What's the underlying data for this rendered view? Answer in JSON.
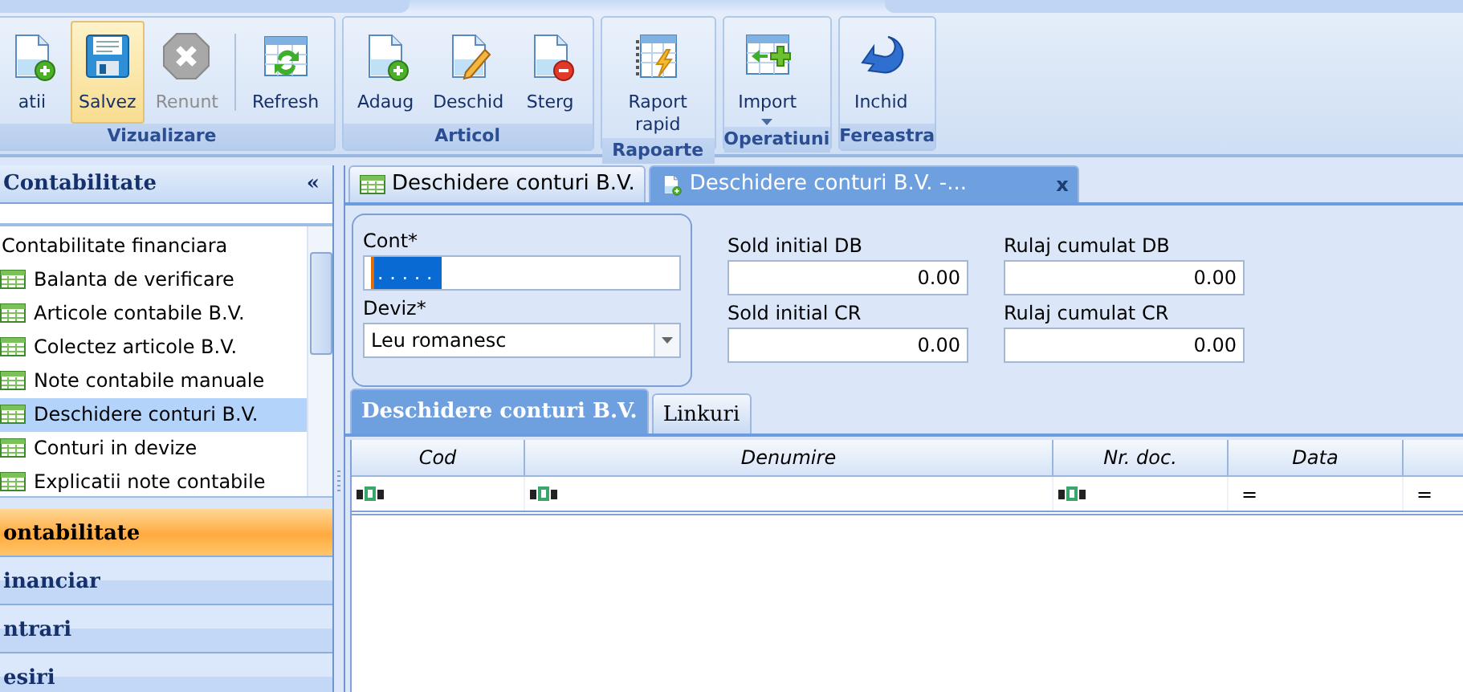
{
  "ribbon": {
    "groups": [
      {
        "label": "Vizualizare",
        "buttons": [
          {
            "label": "atii",
            "kind": "doc-add",
            "highlighted": false,
            "disabled": false
          },
          {
            "label": "Salvez",
            "kind": "save",
            "highlighted": true,
            "disabled": false
          },
          {
            "label": "Renunt",
            "kind": "cancel",
            "highlighted": false,
            "disabled": true
          },
          {
            "kind": "separator"
          },
          {
            "label": "Refresh",
            "kind": "refresh",
            "highlighted": false,
            "disabled": false
          }
        ]
      },
      {
        "label": "Articol",
        "buttons": [
          {
            "label": "Adaug",
            "kind": "doc-add",
            "highlighted": false,
            "disabled": false
          },
          {
            "label": "Deschid",
            "kind": "doc-edit",
            "highlighted": false,
            "disabled": false
          },
          {
            "label": "Sterg",
            "kind": "doc-remove",
            "highlighted": false,
            "disabled": false
          }
        ]
      },
      {
        "label": "Rapoarte",
        "buttons": [
          {
            "label": "Raport rapid",
            "kind": "report",
            "highlighted": false,
            "disabled": false
          }
        ]
      },
      {
        "label": "Operatiuni",
        "buttons": [
          {
            "label": "Import",
            "kind": "import",
            "highlighted": false,
            "disabled": false,
            "dropdown": true
          }
        ]
      },
      {
        "label": "Fereastra",
        "buttons": [
          {
            "label": "Inchid",
            "kind": "close",
            "highlighted": false,
            "disabled": false
          }
        ]
      }
    ]
  },
  "sidebar": {
    "title": "Contabilitate",
    "collapse": "«",
    "tree": {
      "label": "Contabilitate financiara",
      "children": [
        {
          "label": "Balanta de verificare",
          "selected": false
        },
        {
          "label": "Articole contabile B.V.",
          "selected": false
        },
        {
          "label": "Colectez articole B.V.",
          "selected": false
        },
        {
          "label": "Note contabile manuale",
          "selected": false
        },
        {
          "label": "Deschidere conturi B.V.",
          "selected": true
        },
        {
          "label": "Conturi in devize",
          "selected": false
        },
        {
          "label": "Explicatii note contabile",
          "selected": false
        }
      ]
    },
    "nav": [
      {
        "label": "ontabilitate",
        "selected": true
      },
      {
        "label": "inanciar",
        "selected": false
      },
      {
        "label": "ntrari",
        "selected": false
      },
      {
        "label": "esiri",
        "selected": false
      }
    ]
  },
  "doc_tabs": [
    {
      "label": "Deschidere conturi B.V.",
      "kind": "grid",
      "selected": false
    },
    {
      "label": "Deschidere conturi B.V. -...",
      "kind": "new",
      "selected": true,
      "close": "x"
    }
  ],
  "form": {
    "left": [
      {
        "label": "Cont*",
        "kind": "text",
        "value": " .  .  .  .  .",
        "value_selected": true
      },
      {
        "label": "Deviz*",
        "kind": "combo",
        "value": "Leu romanesc",
        "value_selected": false
      }
    ],
    "middle": [
      {
        "label": "Sold initial DB",
        "kind": "number",
        "value": "0.00"
      },
      {
        "label": "Sold initial CR",
        "kind": "number",
        "value": "0.00"
      }
    ],
    "right": [
      {
        "label": "Rulaj cumulat DB",
        "kind": "number",
        "value": "0.00"
      },
      {
        "label": "Rulaj cumulat CR",
        "kind": "number",
        "value": "0.00"
      }
    ]
  },
  "detail_tabs": [
    {
      "label": "Deschidere conturi B.V.",
      "selected": true
    },
    {
      "label": "Linkuri",
      "selected": false
    }
  ],
  "table": {
    "columns": [
      "Cod",
      "Denumire",
      "Nr. doc.",
      "Data",
      ""
    ],
    "filter_row": [
      {
        "kind": "text"
      },
      {
        "kind": "text"
      },
      {
        "kind": "text"
      },
      {
        "kind": "op",
        "text": "="
      },
      {
        "kind": "op",
        "text": "="
      }
    ]
  }
}
